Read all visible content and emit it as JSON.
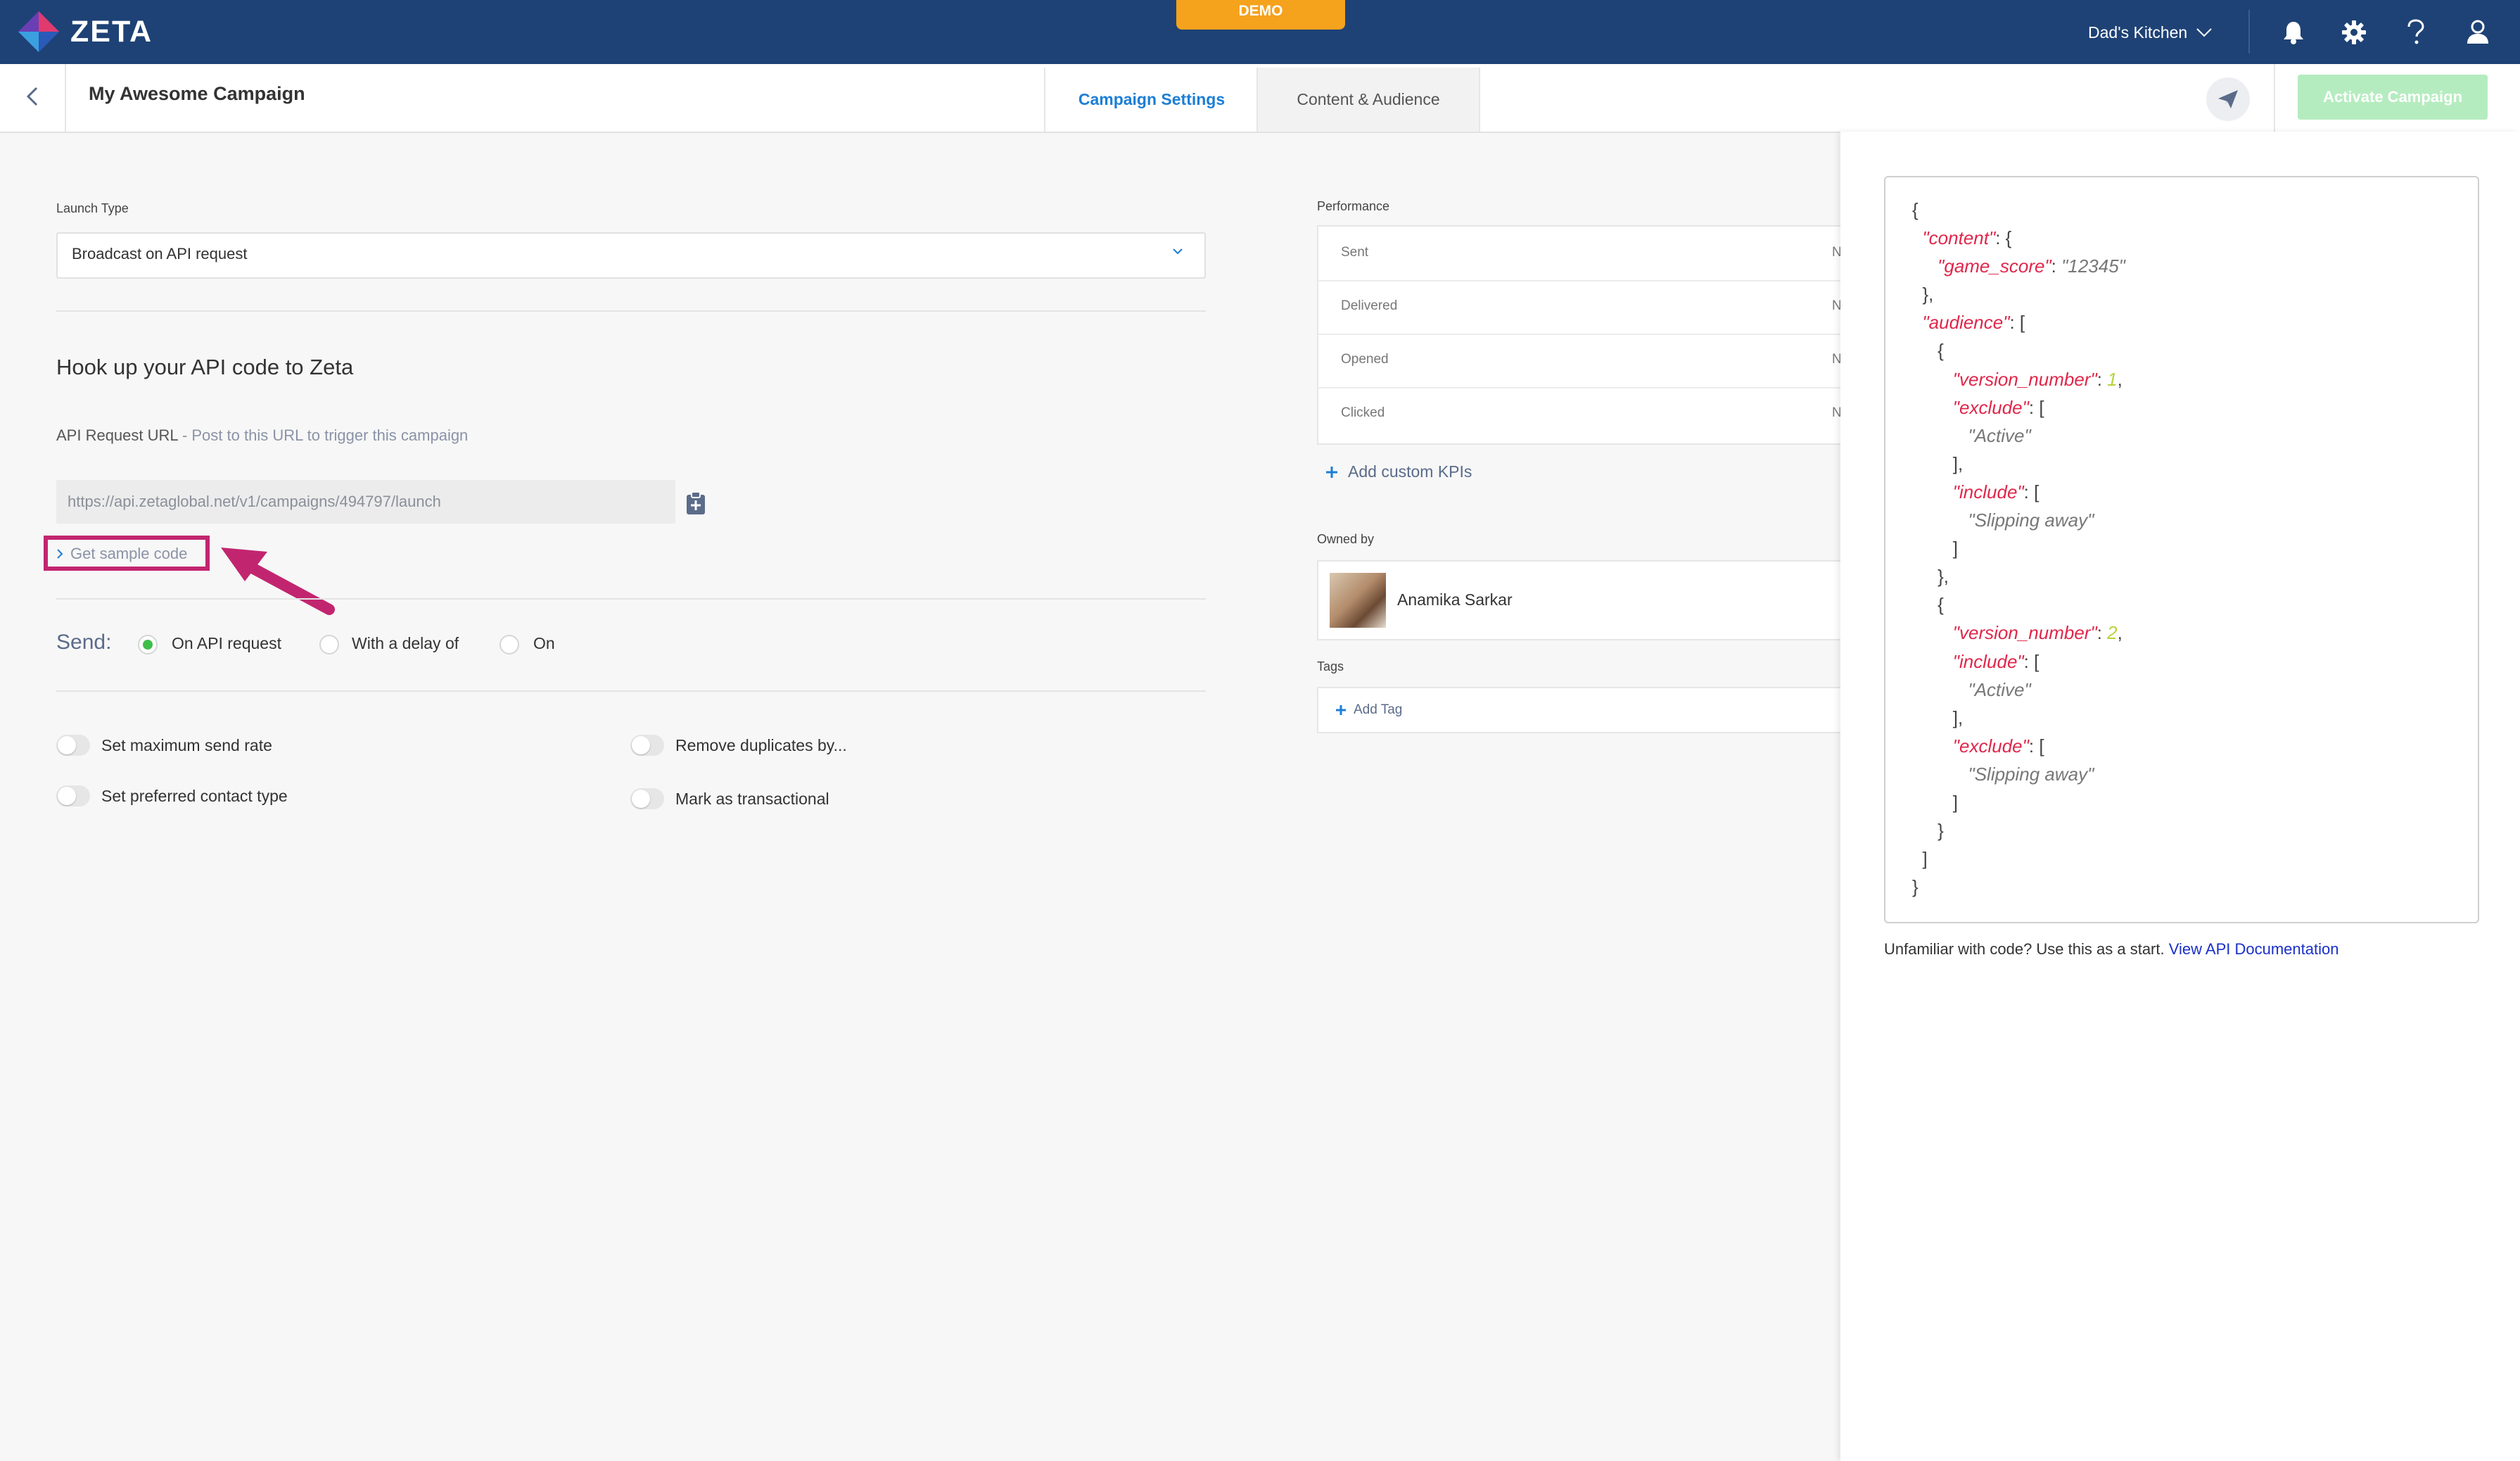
{
  "topbar": {
    "brand": "ZETA",
    "env_badge": "DEMO",
    "account_name": "Dad's Kitchen",
    "icons": [
      "bell-icon",
      "gear-icon",
      "help-icon",
      "user-icon"
    ]
  },
  "header": {
    "campaign_title": "My Awesome Campaign",
    "tabs": [
      {
        "label": "Campaign Settings",
        "active": true
      },
      {
        "label": "Content & Audience",
        "active": false
      }
    ],
    "activate_label": "Activate Campaign"
  },
  "form": {
    "launch_type_label": "Launch Type",
    "launch_type_value": "Broadcast on API request",
    "hook_title": "Hook up your API code to Zeta",
    "api_label": "API Request URL",
    "api_label_hint": " - Post to this URL to trigger this campaign",
    "api_url": "https://api.zetaglobal.net/v1/campaigns/494797/launch",
    "sample_code_link": "Get sample code",
    "send_label": "Send:",
    "send_options": [
      {
        "label": "On API request",
        "selected": true
      },
      {
        "label": "With a delay of",
        "selected": false
      },
      {
        "label": "On",
        "selected": false
      }
    ],
    "toggles": [
      {
        "label": "Set maximum send rate",
        "on": false
      },
      {
        "label": "Set preferred contact type",
        "on": false
      },
      {
        "label": "Remove duplicates by...",
        "on": false
      },
      {
        "label": "Mark as transactional",
        "on": false
      }
    ]
  },
  "performance": {
    "label": "Performance",
    "rows": [
      {
        "name": "Sent",
        "value": "N"
      },
      {
        "name": "Delivered",
        "value": "N"
      },
      {
        "name": "Opened",
        "value": "N"
      },
      {
        "name": "Clicked",
        "value": "N"
      }
    ],
    "add_kpis": "Add custom KPIs",
    "owned_by_label": "Owned by",
    "owner_name": "Anamika Sarkar",
    "tags_label": "Tags",
    "add_tag": "Add Tag"
  },
  "sample_panel": {
    "code": [
      [
        [
          "p",
          "{"
        ]
      ],
      [
        [
          "p",
          "  "
        ],
        [
          "k",
          "\"content\""
        ],
        [
          "p",
          ": {"
        ]
      ],
      [
        [
          "p",
          "     "
        ],
        [
          "k",
          "\"game_score\""
        ],
        [
          "p",
          ": "
        ],
        [
          "s",
          "\"12345\""
        ]
      ],
      [
        [
          "p",
          "  },"
        ]
      ],
      [
        [
          "p",
          "  "
        ],
        [
          "k",
          "\"audience\""
        ],
        [
          "p",
          ": ["
        ]
      ],
      [
        [
          "p",
          "     {"
        ]
      ],
      [
        [
          "p",
          "        "
        ],
        [
          "k",
          "\"version_number\""
        ],
        [
          "p",
          ": "
        ],
        [
          "n",
          "1"
        ],
        [
          "p",
          ","
        ]
      ],
      [
        [
          "p",
          "        "
        ],
        [
          "k",
          "\"exclude\""
        ],
        [
          "p",
          ": ["
        ]
      ],
      [
        [
          "p",
          "           "
        ],
        [
          "s",
          "\"Active\""
        ]
      ],
      [
        [
          "p",
          "        ],"
        ]
      ],
      [
        [
          "p",
          "        "
        ],
        [
          "k",
          "\"include\""
        ],
        [
          "p",
          ": ["
        ]
      ],
      [
        [
          "p",
          "           "
        ],
        [
          "s",
          "\"Slipping away\""
        ]
      ],
      [
        [
          "p",
          "        ]"
        ]
      ],
      [
        [
          "p",
          "     },"
        ]
      ],
      [
        [
          "p",
          "     {"
        ]
      ],
      [
        [
          "p",
          "        "
        ],
        [
          "k",
          "\"version_number\""
        ],
        [
          "p",
          ": "
        ],
        [
          "n",
          "2"
        ],
        [
          "p",
          ","
        ]
      ],
      [
        [
          "p",
          "        "
        ],
        [
          "k",
          "\"include\""
        ],
        [
          "p",
          ": ["
        ]
      ],
      [
        [
          "p",
          "           "
        ],
        [
          "s",
          "\"Active\""
        ]
      ],
      [
        [
          "p",
          "        ],"
        ]
      ],
      [
        [
          "p",
          "        "
        ],
        [
          "k",
          "\"exclude\""
        ],
        [
          "p",
          ": ["
        ]
      ],
      [
        [
          "p",
          "           "
        ],
        [
          "s",
          "\"Slipping away\""
        ]
      ],
      [
        [
          "p",
          "        ]"
        ]
      ],
      [
        [
          "p",
          "     }"
        ]
      ],
      [
        [
          "p",
          "  ]"
        ]
      ],
      [
        [
          "p",
          "}"
        ]
      ]
    ],
    "help_text": "Unfamiliar with code? Use this as a start. ",
    "help_link": "View API Documentation"
  },
  "colors": {
    "topbar": "#1e4275",
    "accent_blue": "#1c7ed6",
    "demo_orange": "#f5a21d",
    "activate_green": "#b5ecbf",
    "highlight_magenta": "#c2256f",
    "radio_green": "#3fbe4a"
  }
}
